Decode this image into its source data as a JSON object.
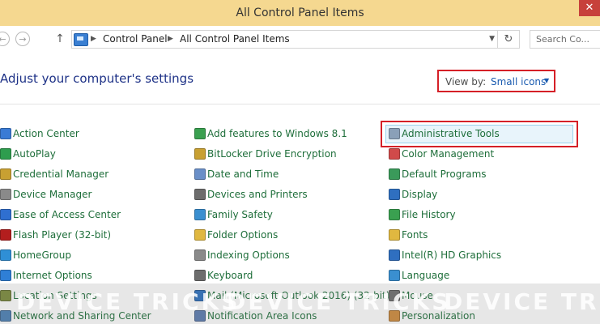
{
  "window": {
    "title": "All Control Panel Items",
    "close_glyph": "✕"
  },
  "nav": {
    "back_glyph": "←",
    "forward_glyph": "→",
    "up_glyph": "↑",
    "breadcrumbs": [
      "Control Panel",
      "All Control Panel Items"
    ],
    "crumb_sep": "▶",
    "dropdown_glyph": "▼",
    "refresh_glyph": "↻",
    "search_placeholder": "Search Co..."
  },
  "header": {
    "heading": "Adjust your computer's settings",
    "view_by_label": "View by:",
    "view_by_value": "Small icons",
    "view_by_arrow": "▼"
  },
  "columns": [
    [
      {
        "label": "Action Center",
        "icon": "flag-icon",
        "color": "#3a7bd5"
      },
      {
        "label": "AutoPlay",
        "icon": "autoplay-icon",
        "color": "#2e9d4e"
      },
      {
        "label": "Credential Manager",
        "icon": "vault-icon",
        "color": "#c8a032"
      },
      {
        "label": "Device Manager",
        "icon": "device-manager-icon",
        "color": "#8a8a8a"
      },
      {
        "label": "Ease of Access Center",
        "icon": "ease-of-access-icon",
        "color": "#2f6fd0"
      },
      {
        "label": "Flash Player (32-bit)",
        "icon": "flash-icon",
        "color": "#b31e1e"
      },
      {
        "label": "HomeGroup",
        "icon": "homegroup-icon",
        "color": "#2f8fd6"
      },
      {
        "label": "Internet Options",
        "icon": "globe-icon",
        "color": "#2f7fd6"
      },
      {
        "label": "Location Settings",
        "icon": "location-icon",
        "color": "#7a8a3a"
      },
      {
        "label": "Network and Sharing Center",
        "icon": "network-icon",
        "color": "#4a7fb5"
      }
    ],
    [
      {
        "label": "Add features to Windows 8.1",
        "icon": "add-features-icon",
        "color": "#3aa050"
      },
      {
        "label": "BitLocker Drive Encryption",
        "icon": "bitlocker-icon",
        "color": "#c8a032"
      },
      {
        "label": "Date and Time",
        "icon": "clock-icon",
        "color": "#6a8fc8"
      },
      {
        "label": "Devices and Printers",
        "icon": "printer-icon",
        "color": "#6d6d6d"
      },
      {
        "label": "Family Safety",
        "icon": "family-safety-icon",
        "color": "#3a8fd0"
      },
      {
        "label": "Folder Options",
        "icon": "folder-icon",
        "color": "#e0b840"
      },
      {
        "label": "Indexing Options",
        "icon": "indexing-icon",
        "color": "#8a8a8a"
      },
      {
        "label": "Keyboard",
        "icon": "keyboard-icon",
        "color": "#6d6d6d"
      },
      {
        "label": "Mail (Microsoft Outlook 2016) (32-bit)",
        "icon": "mail-icon",
        "color": "#2a6fc0"
      },
      {
        "label": "Notification Area Icons",
        "icon": "notification-icon",
        "color": "#5a7ab0"
      }
    ],
    [
      {
        "label": "Administrative Tools",
        "icon": "admin-tools-icon",
        "color": "#8aa0b8"
      },
      {
        "label": "Color Management",
        "icon": "color-management-icon",
        "color": "#d04a4a"
      },
      {
        "label": "Default Programs",
        "icon": "default-programs-icon",
        "color": "#3a9a5a"
      },
      {
        "label": "Display",
        "icon": "display-icon",
        "color": "#2f6fc0"
      },
      {
        "label": "File History",
        "icon": "file-history-icon",
        "color": "#3aa050"
      },
      {
        "label": "Fonts",
        "icon": "fonts-icon",
        "color": "#e0b840"
      },
      {
        "label": "Intel(R) HD Graphics",
        "icon": "intel-graphics-icon",
        "color": "#2f6fc0"
      },
      {
        "label": "Language",
        "icon": "language-icon",
        "color": "#3a8fd0"
      },
      {
        "label": "Mouse",
        "icon": "mouse-icon",
        "color": "#6d6d6d"
      },
      {
        "label": "Personalization",
        "icon": "personalization-icon",
        "color": "#d08a3a"
      }
    ]
  ],
  "watermark": [
    "DEVICE TRICKS",
    "DEVICE TRICKS",
    "DEVICE TRI"
  ]
}
